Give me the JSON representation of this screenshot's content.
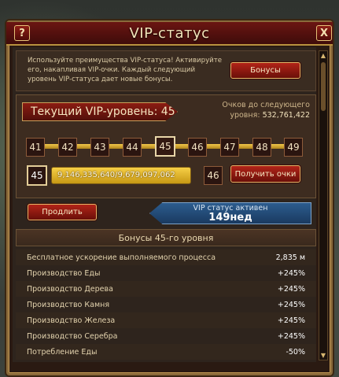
{
  "window": {
    "title": "VIP-статус",
    "help_label": "?",
    "close_label": "X"
  },
  "intro": {
    "text": "Используйте преимущества VIP-статуса! Активируйте его, накапливая VIP-очки. Каждый следующий уровень VIP-статуса дает новые бонусы.",
    "bonus_button": "Бонусы"
  },
  "status": {
    "current_level_label": "Текущий VIP-уровень: 45",
    "next_label": "Очков до следующего",
    "next_value_label": "уровня:",
    "next_value": "532,761,422",
    "levels": [
      "41",
      "42",
      "43",
      "44",
      "45",
      "46",
      "47",
      "48",
      "49"
    ],
    "current_level": "45",
    "next_level": "46",
    "progress_text": "9,146,335,640/9,679,097,062",
    "progress_fraction": 0.945,
    "get_points_button": "Получить очки",
    "extend_button": "Продлить",
    "active_label": "VIP статус активен",
    "active_time": "149нед"
  },
  "bonuses": {
    "header": "Бонусы 45-го уровня",
    "rows": [
      {
        "label": "Бесплатное ускорение выполняемого процесса",
        "value": "2,835 м"
      },
      {
        "label": "Производство Еды",
        "value": "+245%"
      },
      {
        "label": "Производство Дерева",
        "value": "+245%"
      },
      {
        "label": "Производство Камня",
        "value": "+245%"
      },
      {
        "label": "Производство Железа",
        "value": "+245%"
      },
      {
        "label": "Производство Серебра",
        "value": "+245%"
      },
      {
        "label": "Потребление Еды",
        "value": "-50%"
      }
    ]
  },
  "colors": {
    "accent_gold": "#f0c64a",
    "button_red": "#b22418",
    "active_blue": "#2c5c8e"
  }
}
